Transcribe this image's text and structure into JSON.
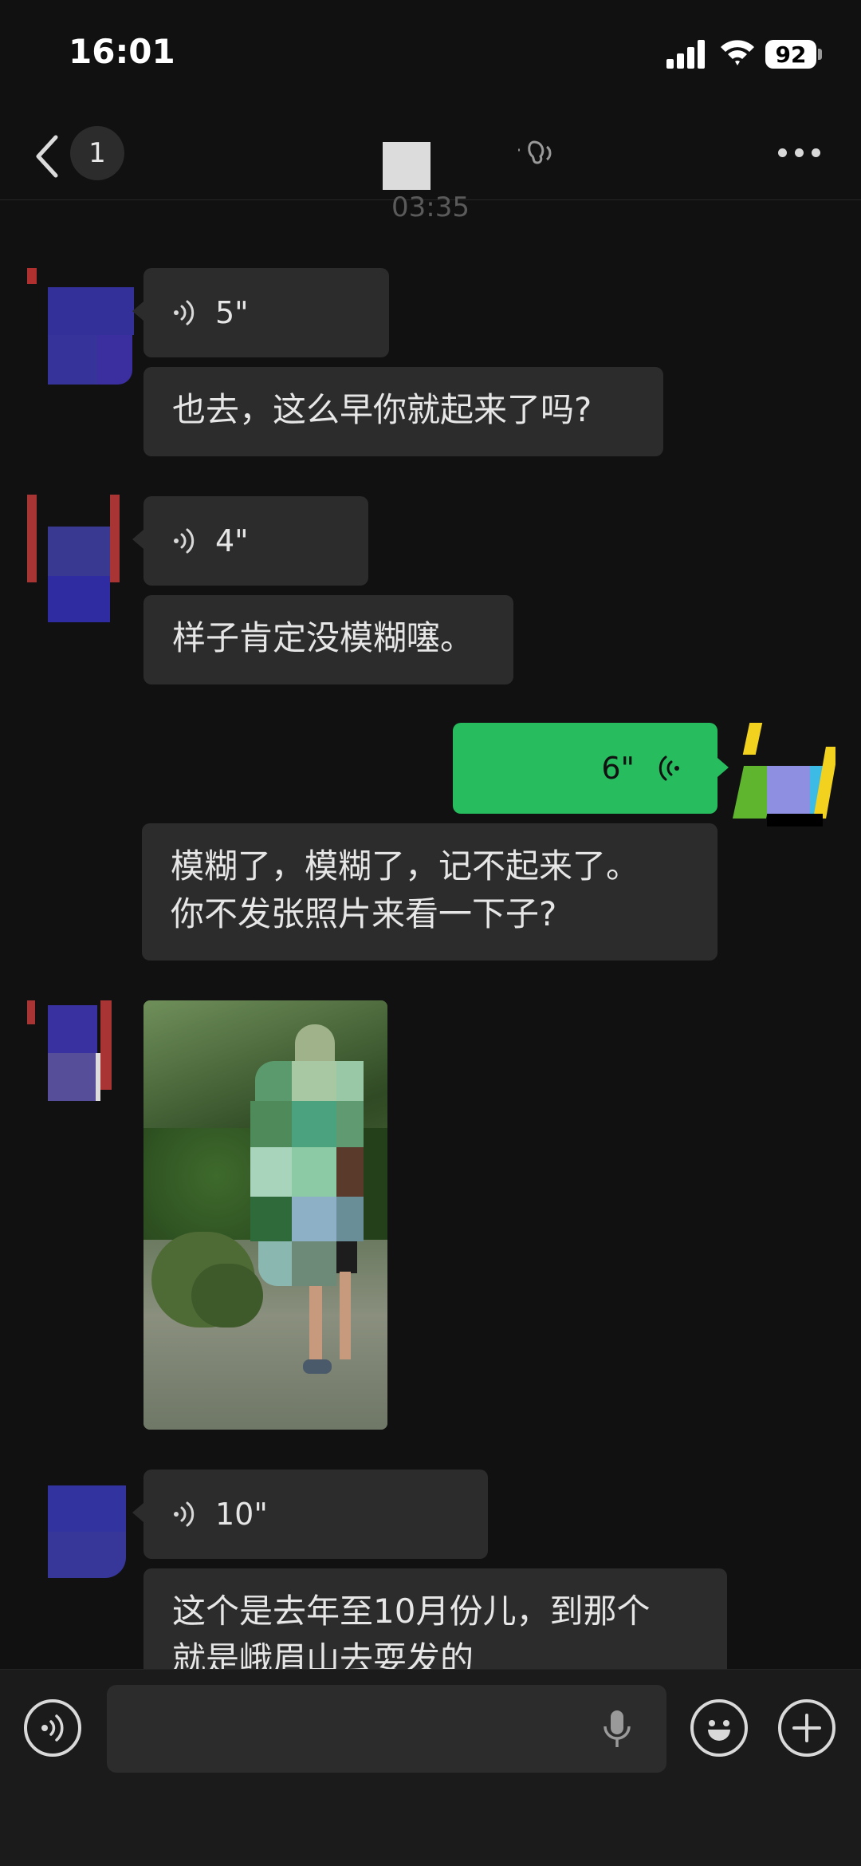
{
  "status_bar": {
    "time": "16:01",
    "battery": "92",
    "signal_icon": "cellular-signal-icon",
    "wifi_icon": "wifi-icon"
  },
  "header": {
    "unread_count": "1",
    "back_icon": "chevron-left-icon",
    "more_icon": "ellipsis-icon",
    "voice_mode_icon": "ear-speaker-icon"
  },
  "timestamp": "03:35",
  "messages": [
    {
      "side": "left",
      "type": "voice",
      "duration": "5\""
    },
    {
      "side": "left",
      "type": "text",
      "text": "也去，这么早你就起来了吗?"
    },
    {
      "side": "left",
      "type": "voice",
      "duration": "4\""
    },
    {
      "side": "left",
      "type": "text",
      "text": "样子肯定没模糊噻。"
    },
    {
      "side": "right",
      "type": "voice",
      "duration": "6\""
    },
    {
      "side": "right",
      "type": "text",
      "lines": [
        "模糊了，模糊了，记不起来了。",
        "你不发张照片来看一下子?"
      ]
    },
    {
      "side": "left",
      "type": "image"
    },
    {
      "side": "left",
      "type": "voice",
      "duration": "10\""
    },
    {
      "side": "left",
      "type": "text",
      "lines": [
        "这个是去年至10月份儿，到那个",
        "就是峨眉山去耍发的"
      ]
    }
  ],
  "input_bar": {
    "voice_toggle_icon": "voice-input-icon",
    "mic_icon": "microphone-icon",
    "emoji_icon": "emoji-icon",
    "plus_icon": "plus-icon"
  },
  "colors": {
    "background": "#111111",
    "bubble": "#2c2c2c",
    "sent_voice_bubble": "#27bd5f",
    "input_bar": "#1b1b1b"
  }
}
